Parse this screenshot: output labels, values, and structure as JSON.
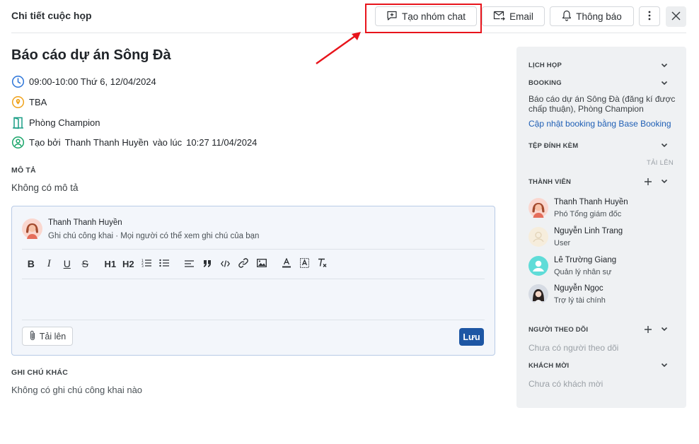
{
  "header": {
    "title": "Chi tiết cuộc họp",
    "create_chat_label": "Tạo nhóm chat",
    "email_label": "Email",
    "notify_label": "Thông báo"
  },
  "meeting": {
    "title": "Báo cáo dự án Sông Đà",
    "time": "09:00-10:00 Thứ 6, 12/04/2024",
    "location": "TBA",
    "room": "Phòng Champion",
    "created_prefix": "Tạo bởi",
    "created_by": "Thanh Thanh Huyền",
    "created_mid": "vào lúc",
    "created_at": "10:27 11/04/2024"
  },
  "description": {
    "label": "MÔ TẢ",
    "text": "Không có mô tả"
  },
  "comment": {
    "author": "Thanh Thanh Huyền",
    "note": "Ghi chú công khai · Mọi người có thể xem ghi chú của bạn",
    "toolbar": [
      "B",
      "I",
      "U",
      "S",
      "H1",
      "H2",
      "ordered-list",
      "bullet-list",
      "align",
      "quote",
      "code",
      "link",
      "image",
      "text-color",
      "highlight",
      "clear-format"
    ],
    "upload_label": "Tải lên",
    "save_label": "Lưu"
  },
  "other_notes": {
    "label": "GHI CHÚ KHÁC",
    "text": "Không có ghi chú công khai nào"
  },
  "sidebar": {
    "schedule_label": "LỊCH HỌP",
    "booking_label": "BOOKING",
    "booking_text": "Báo cáo dự án Sông Đà (đăng kí được chấp thuận), Phòng Champion",
    "booking_link": "Cập nhật booking bằng Base Booking",
    "attachments_label": "TỆP ĐÍNH KÈM",
    "attachments_upload": "TẢI LÊN",
    "members_label": "THÀNH VIÊN",
    "members": [
      {
        "name": "Thanh Thanh Huyền",
        "role": "Phó Tổng giám đốc"
      },
      {
        "name": "Nguyễn Linh Trang",
        "role": "User"
      },
      {
        "name": "Lê Trường Giang",
        "role": "Quản lý nhân sự"
      },
      {
        "name": "Nguyễn Ngọc",
        "role": "Trợ lý tài chính"
      }
    ],
    "followers_label": "NGƯỜI THEO DÕI",
    "followers_empty": "Chưa có người theo dõi",
    "guests_label": "KHÁCH MỜI",
    "guests_empty": "Chưa có khách mời"
  },
  "colors": {
    "accent": "#1d56a4",
    "link": "#1f5fb5",
    "highlight_box": "#e8141b",
    "panel_bg": "#eff1f3"
  }
}
